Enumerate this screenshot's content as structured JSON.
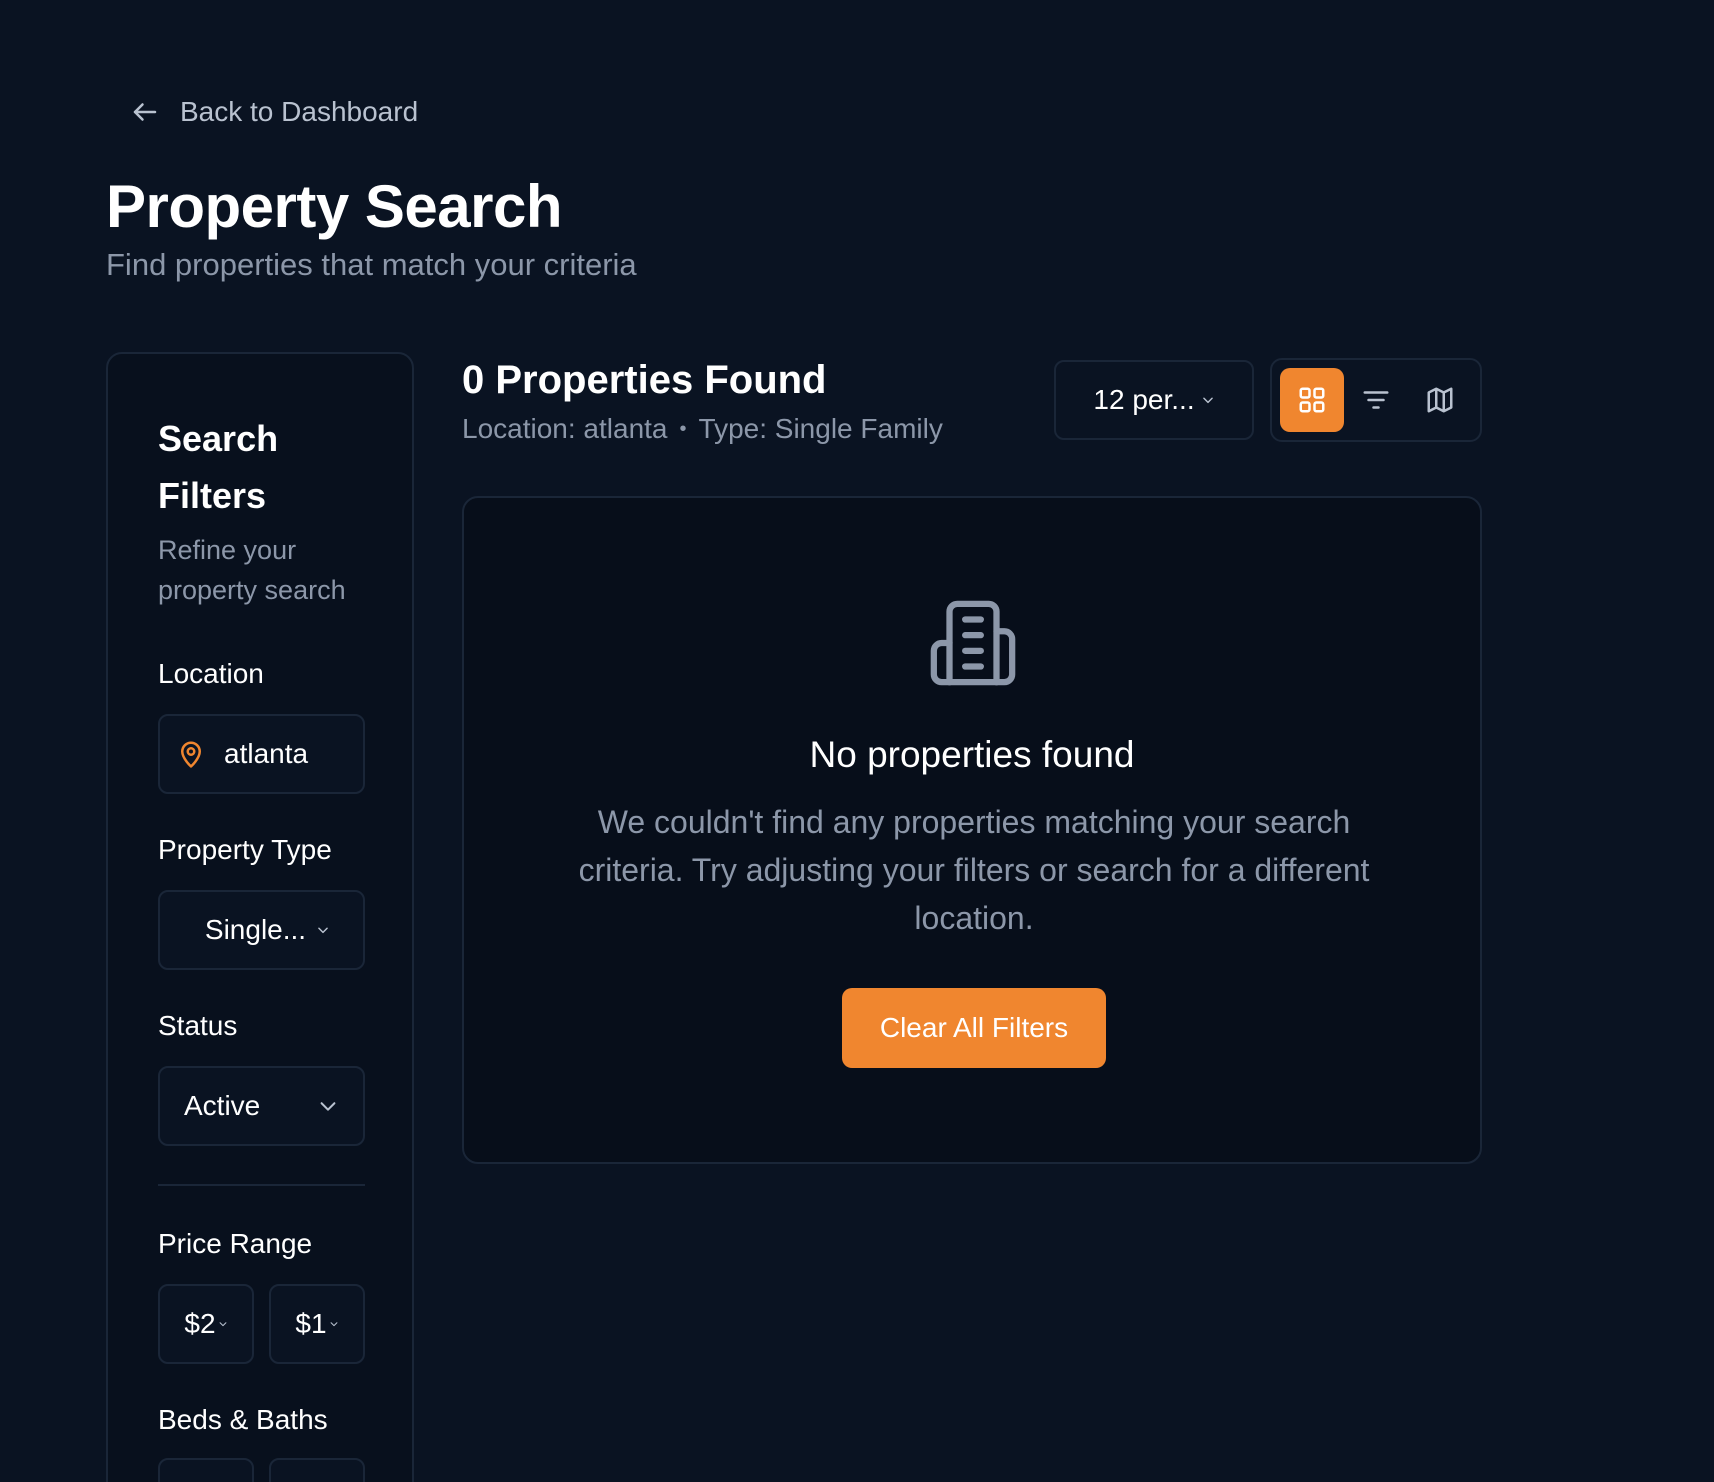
{
  "header": {
    "back_label": "Back to Dashboard",
    "title": "Property Search",
    "subtitle": "Find properties that match your criteria"
  },
  "sidebar": {
    "title": "Search Filters",
    "description": "Refine your property search",
    "location_label": "Location",
    "location_value": "atlanta",
    "property_type_label": "Property Type",
    "property_type_value": "Single...",
    "status_label": "Status",
    "status_value": "Active",
    "price_range_label": "Price Range",
    "price_min": "$2",
    "price_max": "$1",
    "beds_baths_label": "Beds & Baths"
  },
  "results": {
    "title": "0 Properties Found",
    "location_filter": "Location: atlanta",
    "separator": "•",
    "type_filter": "Type: Single Family",
    "per_page": "12 per...",
    "views": [
      "grid-icon",
      "list-filter-icon",
      "map-icon"
    ],
    "active_view": "grid"
  },
  "empty_state": {
    "icon": "building-icon",
    "title": "No properties found",
    "description": "We couldn't find any properties matching your search criteria. Try adjusting your filters or search for a different location.",
    "button_label": "Clear All Filters"
  },
  "colors": {
    "background": "#0a1322",
    "accent": "#f0862f",
    "muted_text": "#8c97a9",
    "border": "#1a2638"
  }
}
